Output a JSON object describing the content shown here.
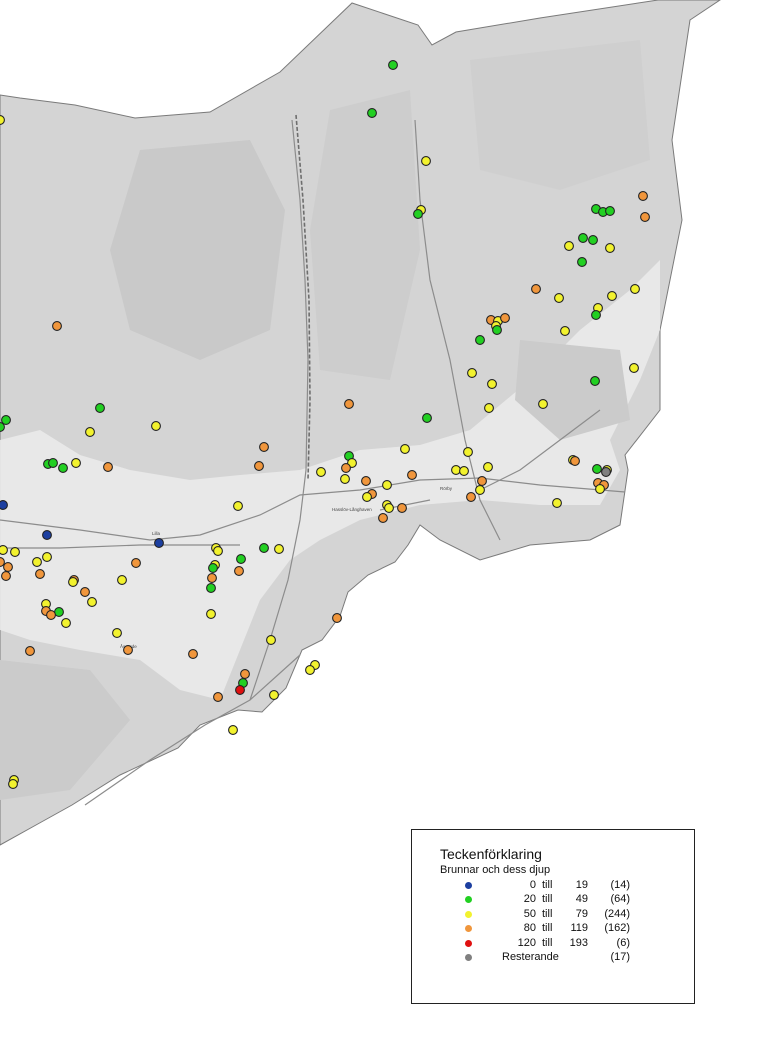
{
  "legend": {
    "title": "Teckenförklaring",
    "subtitle": "Brunnar och dess djup",
    "till_word": "till",
    "classes": [
      {
        "min": "0",
        "max": "19",
        "count": "(14)",
        "color": "#1c3fa0"
      },
      {
        "min": "20",
        "max": "49",
        "count": "(64)",
        "color": "#22d022"
      },
      {
        "min": "50",
        "max": "79",
        "count": "(244)",
        "color": "#f2f22e"
      },
      {
        "min": "80",
        "max": "119",
        "count": "(162)",
        "color": "#f0963c"
      },
      {
        "min": "120",
        "max": "193",
        "count": "(6)",
        "color": "#e01010"
      }
    ],
    "rest": {
      "label": "Resterande",
      "count": "(17)",
      "color": "#808080"
    }
  },
  "map": {
    "land_color": "#d6d6d6",
    "urban_color": "#efefef",
    "road_color": "#8a8a8a",
    "well_outline": "#222222",
    "place_labels": [
      "Hasslöv-Långhaven",
      "Åsgärde",
      "Lilla",
      "Rörby"
    ]
  }
}
